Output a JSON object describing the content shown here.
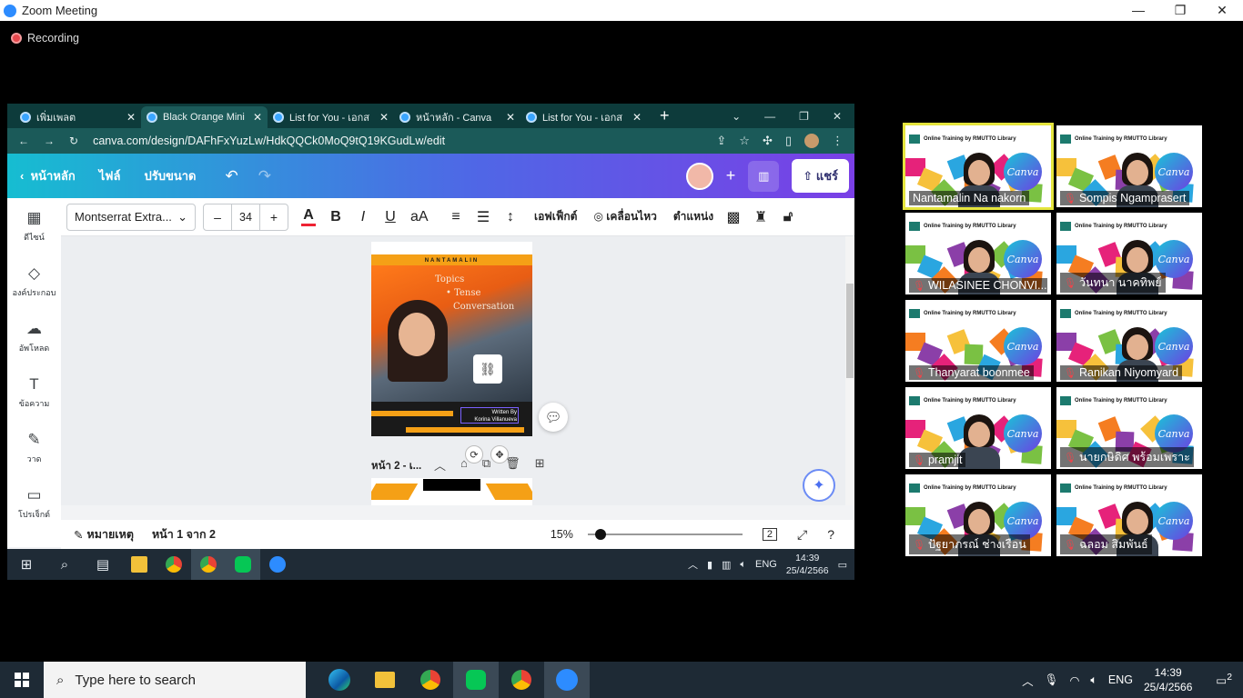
{
  "zoom": {
    "title": "Zoom Meeting",
    "recording_label": "Recording",
    "controls": {
      "minimize": "—",
      "maximize": "❐",
      "close": "✕"
    }
  },
  "browser": {
    "tabs": [
      {
        "label": "เพิ่มเพลต",
        "active": false
      },
      {
        "label": "Black Orange Mini",
        "active": true
      },
      {
        "label": "List for You - เอกส",
        "active": false
      },
      {
        "label": "หน้าหลัก - Canva",
        "active": false
      },
      {
        "label": "List for You - เอกส",
        "active": false
      }
    ],
    "new_tab": "+",
    "url": "canva.com/design/DAFhFxYuzLw/HdkQQCk0MoQ9tQ19KGudLw/edit"
  },
  "canva": {
    "home": "หน้าหลัก",
    "file": "ไฟล์",
    "resize": "ปรับขนาด",
    "share": "แชร์",
    "sidebar": [
      {
        "label": "ดีไซน์",
        "icon": "▦"
      },
      {
        "label": "องค์ประกอบ",
        "icon": "◇"
      },
      {
        "label": "อัพโหลด",
        "icon": "☁"
      },
      {
        "label": "ข้อความ",
        "icon": "T"
      },
      {
        "label": "วาด",
        "icon": "✎"
      },
      {
        "label": "โปรเจ็กต์",
        "icon": "▭"
      }
    ],
    "toolbar": {
      "font": "Montserrat Extra...",
      "size": "34",
      "minus": "–",
      "plus": "+",
      "effects": "เอฟเฟ็กต์",
      "animate": "เคลื่อนไหว",
      "position": "ตำแหน่ง"
    },
    "design": {
      "band_text": "NANTAMALIN",
      "topics": "Topics",
      "topic_items": [
        "Tense",
        "Conversation"
      ],
      "written_by": "Written By",
      "author": "Korina Villanueva"
    },
    "page2_label": "หน้า 2 - เ...",
    "status": {
      "notes": "หมายเหตุ",
      "page": "หน้า 1 จาก 2",
      "zoom": "15%",
      "pages_badge": "2"
    }
  },
  "inner_taskbar": {
    "lang": "ENG",
    "time": "14:39",
    "date": "25/4/2566"
  },
  "participants": [
    {
      "name": "Nantamalin Na nakorn",
      "muted": false,
      "active": true,
      "has_video": true
    },
    {
      "name": "Sompis Ngamprasert",
      "muted": true,
      "active": false,
      "has_video": true
    },
    {
      "name": "WILASINEE CHONVI...",
      "muted": true,
      "active": false,
      "has_video": true
    },
    {
      "name": "วันทนา นาคทิพย์",
      "muted": true,
      "active": false,
      "has_video": true
    },
    {
      "name": "Thanyarat boonmee",
      "muted": true,
      "active": false,
      "has_video": false
    },
    {
      "name": "Ranikan Niyomyard",
      "muted": true,
      "active": false,
      "has_video": true
    },
    {
      "name": "pramjit",
      "muted": true,
      "active": false,
      "has_video": true
    },
    {
      "name": "นายกษิดิศ พร้อมเพราะ",
      "muted": true,
      "active": false,
      "has_video": false
    },
    {
      "name": "ปัฐยาภรณ์ ช่างเรือน",
      "muted": true,
      "active": false,
      "has_video": true
    },
    {
      "name": "ฉลอม สิมพันธ์",
      "muted": true,
      "active": false,
      "has_video": true
    }
  ],
  "virtual_bg_text": "Online Training by RMUTTO Library",
  "canva_badge": "Canva",
  "taskbar": {
    "search_placeholder": "Type here to search",
    "lang": "ENG",
    "time": "14:39",
    "date": "25/4/2566",
    "notifications": "2"
  }
}
